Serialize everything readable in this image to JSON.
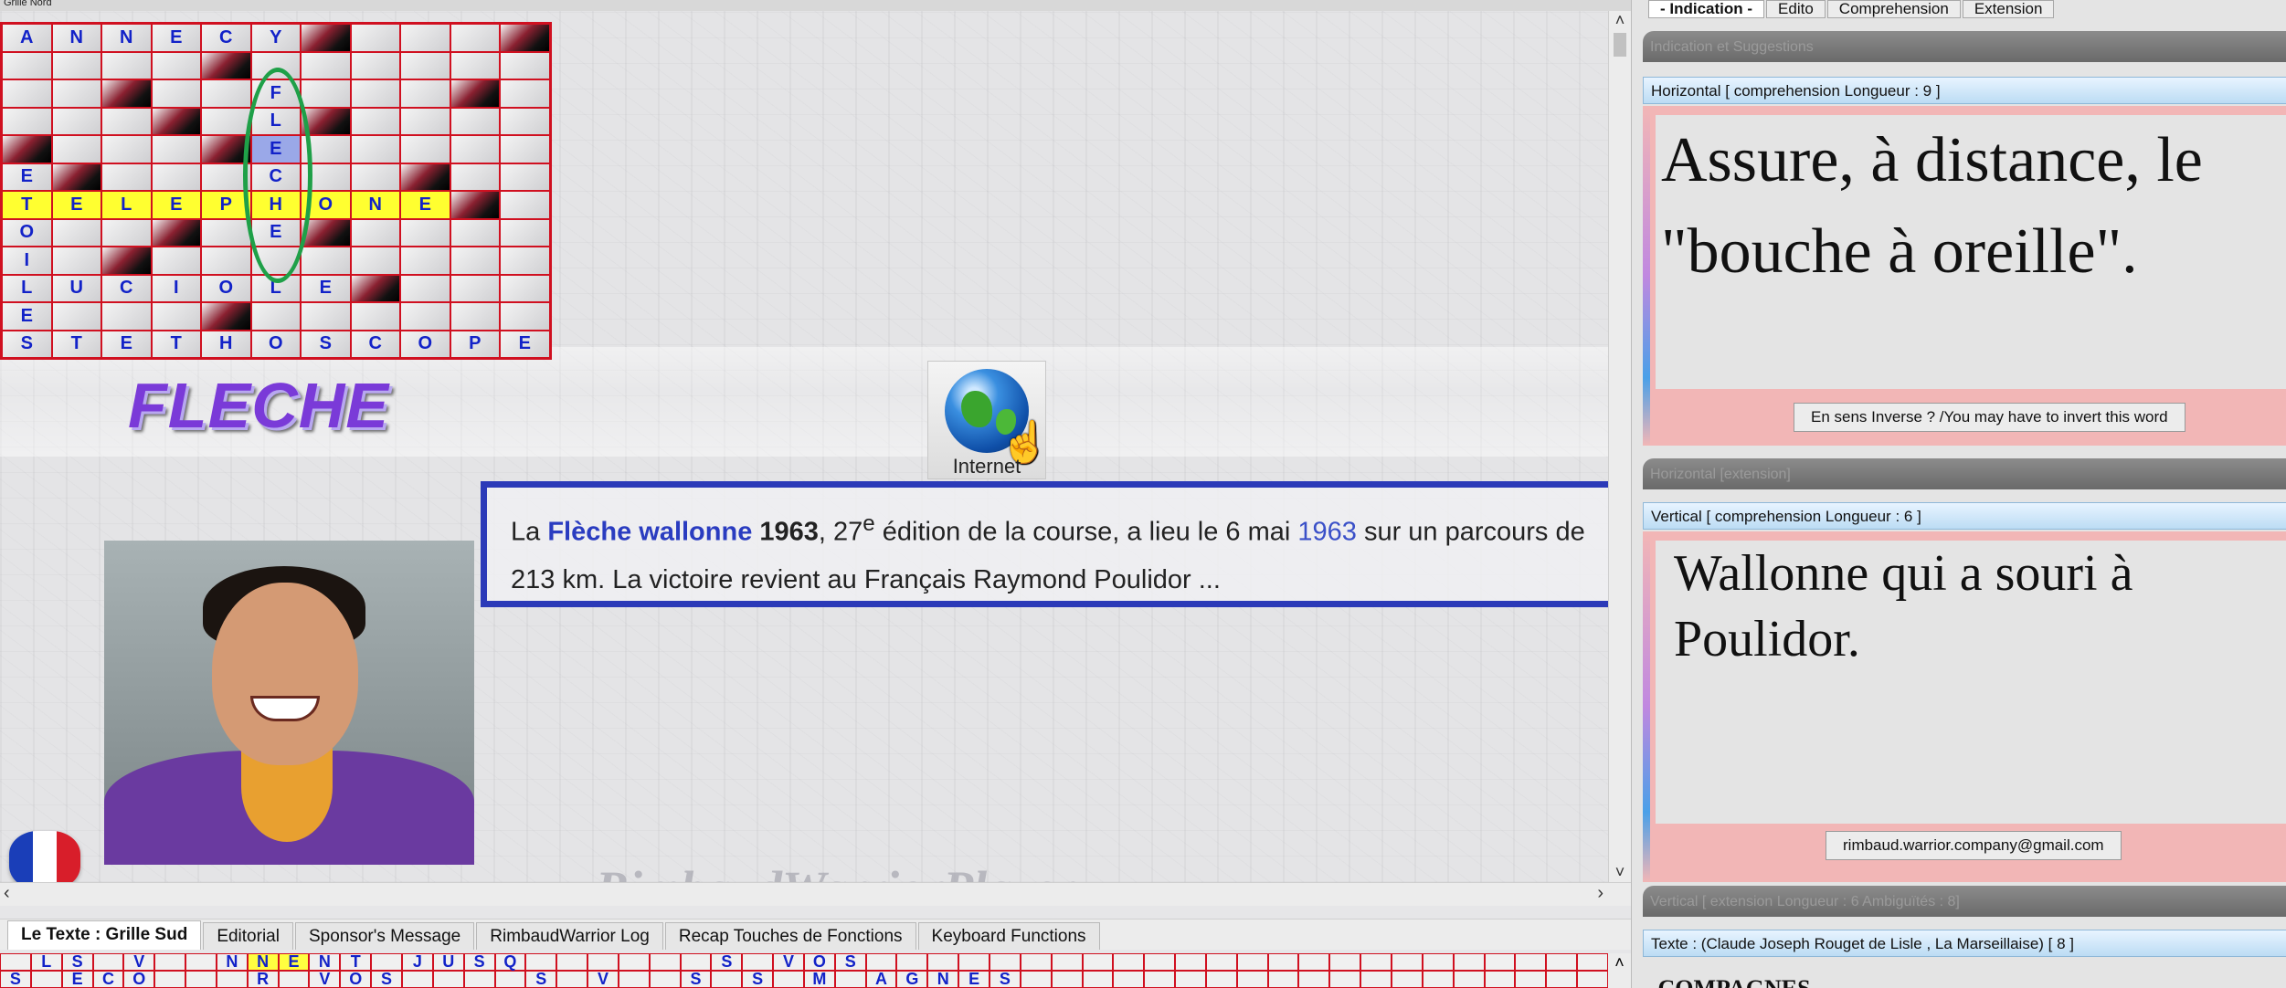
{
  "app": {
    "title_strip": "Grille Nord",
    "watermark": "RimbaudWarriorPlayer"
  },
  "grid": {
    "columns": 11,
    "rows": [
      [
        {
          "t": "A"
        },
        {
          "t": "N"
        },
        {
          "t": "N"
        },
        {
          "t": "E"
        },
        {
          "t": "C"
        },
        {
          "t": "Y"
        },
        {
          "b": 1
        },
        {
          "t": ""
        },
        {
          "t": ""
        },
        {
          "t": ""
        },
        {
          "b": 1
        }
      ],
      [
        {
          "t": ""
        },
        {
          "t": ""
        },
        {
          "t": ""
        },
        {
          "t": ""
        },
        {
          "b": 1
        },
        {
          "t": ""
        },
        {
          "t": ""
        },
        {
          "t": ""
        },
        {
          "t": ""
        },
        {
          "t": ""
        },
        {
          "t": ""
        }
      ],
      [
        {
          "t": ""
        },
        {
          "t": ""
        },
        {
          "b": 1
        },
        {
          "t": ""
        },
        {
          "t": ""
        },
        {
          "t": "F"
        },
        {
          "t": ""
        },
        {
          "t": ""
        },
        {
          "t": ""
        },
        {
          "b": 1
        },
        {
          "t": ""
        }
      ],
      [
        {
          "t": ""
        },
        {
          "t": ""
        },
        {
          "t": ""
        },
        {
          "b": 1
        },
        {
          "t": ""
        },
        {
          "t": "L"
        },
        {
          "b": 1
        },
        {
          "t": ""
        },
        {
          "t": ""
        },
        {
          "t": ""
        },
        {
          "t": ""
        }
      ],
      [
        {
          "b": 1
        },
        {
          "t": ""
        },
        {
          "t": ""
        },
        {
          "t": ""
        },
        {
          "b": 1
        },
        {
          "t": "E",
          "h": 1
        },
        {
          "t": ""
        },
        {
          "t": ""
        },
        {
          "t": ""
        },
        {
          "t": ""
        },
        {
          "t": ""
        }
      ],
      [
        {
          "t": "E"
        },
        {
          "b": 1
        },
        {
          "t": ""
        },
        {
          "t": ""
        },
        {
          "t": ""
        },
        {
          "t": "C"
        },
        {
          "t": ""
        },
        {
          "t": ""
        },
        {
          "b": 1
        },
        {
          "t": ""
        },
        {
          "t": ""
        }
      ],
      [
        {
          "t": "T",
          "y": 1
        },
        {
          "t": "E",
          "y": 1
        },
        {
          "t": "L",
          "y": 1
        },
        {
          "t": "E",
          "y": 1
        },
        {
          "t": "P",
          "y": 1
        },
        {
          "t": "H",
          "y": 1
        },
        {
          "t": "O",
          "y": 1
        },
        {
          "t": "N",
          "y": 1
        },
        {
          "t": "E",
          "y": 1
        },
        {
          "b": 1
        },
        {
          "t": ""
        }
      ],
      [
        {
          "t": "O"
        },
        {
          "t": ""
        },
        {
          "t": ""
        },
        {
          "b": 1
        },
        {
          "t": ""
        },
        {
          "t": "E"
        },
        {
          "b": 1
        },
        {
          "t": ""
        },
        {
          "t": ""
        },
        {
          "t": ""
        },
        {
          "t": ""
        }
      ],
      [
        {
          "t": "I"
        },
        {
          "t": ""
        },
        {
          "b": 1
        },
        {
          "t": ""
        },
        {
          "t": ""
        },
        {
          "t": ""
        },
        {
          "t": ""
        },
        {
          "t": ""
        },
        {
          "t": ""
        },
        {
          "t": ""
        },
        {
          "t": ""
        }
      ],
      [
        {
          "t": "L"
        },
        {
          "t": "U"
        },
        {
          "t": "C"
        },
        {
          "t": "I"
        },
        {
          "t": "O"
        },
        {
          "t": "L"
        },
        {
          "t": "E"
        },
        {
          "b": 1
        },
        {
          "t": ""
        },
        {
          "t": ""
        },
        {
          "t": ""
        }
      ],
      [
        {
          "t": "E"
        },
        {
          "t": ""
        },
        {
          "t": ""
        },
        {
          "t": ""
        },
        {
          "b": 1
        },
        {
          "t": ""
        },
        {
          "t": ""
        },
        {
          "t": ""
        },
        {
          "t": ""
        },
        {
          "t": ""
        },
        {
          "t": ""
        }
      ],
      [
        {
          "t": "S"
        },
        {
          "t": "T"
        },
        {
          "t": "E"
        },
        {
          "t": "T"
        },
        {
          "t": "H"
        },
        {
          "t": "O"
        },
        {
          "t": "S"
        },
        {
          "t": "C"
        },
        {
          "t": "O"
        },
        {
          "t": "P"
        },
        {
          "t": "E"
        }
      ]
    ]
  },
  "word_title": "FLECHE",
  "internet_label": "Internet",
  "info": {
    "p1": "La ",
    "link1": "Flèche wallonne",
    "year_bold": " 1963",
    "p2": ", 27",
    "sup": "e",
    "p3": " édition de la course, a lieu le 6 mai ",
    "link2": "1963",
    "p4": " sur un parcours de 213 km. La victoire revient au Français Raymond Poulidor ..."
  },
  "flag_colors": [
    "#1a3eb8",
    "#ffffff",
    "#d81e2a"
  ],
  "bottom_tabs": [
    "Le Texte : Grille Sud",
    "Editorial",
    "Sponsor's Message",
    "RimbaudWarrior Log",
    "Recap Touches de Fonctions",
    "Keyboard Functions"
  ],
  "bottom_grid": {
    "row1": [
      "",
      "L",
      "S",
      "",
      "V",
      "",
      "",
      "N",
      "N",
      "E",
      "N",
      "T",
      "",
      "J",
      "U",
      "S",
      "Q",
      "",
      "",
      "",
      "",
      "",
      "",
      "S",
      "",
      "V",
      "O",
      "S",
      "",
      "",
      "",
      "",
      "",
      "",
      "",
      "",
      "",
      "",
      "",
      "",
      "",
      "",
      "",
      "",
      "",
      "",
      "",
      "",
      "",
      "",
      "",
      ""
    ],
    "row1_yellow": [
      8,
      9
    ],
    "row2": [
      "S",
      "",
      "E",
      "C",
      "O",
      "",
      "",
      "",
      "R",
      "",
      "V",
      "O",
      "S",
      "",
      "",
      "",
      "",
      "S",
      "",
      "V",
      "",
      "",
      "S",
      "",
      "S",
      "",
      "M",
      "",
      "A",
      "G",
      "N",
      "E",
      "S",
      "",
      "",
      "",
      "",
      "",
      "",
      "",
      "",
      "",
      "",
      "",
      "",
      "",
      "",
      "",
      "",
      "",
      "",
      ""
    ]
  },
  "right": {
    "tabs": [
      "- Indication -",
      "Edito",
      "Comprehension",
      "Extension"
    ],
    "bar1": "Indication et Suggestions",
    "horiz_header": "Horizontal [ comprehension   Longueur : 9 ]",
    "horiz_clue": "Assure, à distance, le \"bouche à oreille\".",
    "invert_btn": "En sens Inverse ? /You may have to invert this word",
    "horiz_ext": "Horizontal [extension]",
    "vert_header": "Vertical [ comprehension   Longueur : 6 ]",
    "vert_clue": "Wallonne qui a souri à Poulidor.",
    "email_btn": "rimbaud.warrior.company@gmail.com",
    "vert_ext": "Vertical [ extension   Longueur : 6     Ambiguïtés : 8]",
    "texte_header": "Texte :  (Claude Joseph Rouget de Lisle , La Marseillaise)  [ 8 ]",
    "texte_content": "...COMPAGNES"
  }
}
